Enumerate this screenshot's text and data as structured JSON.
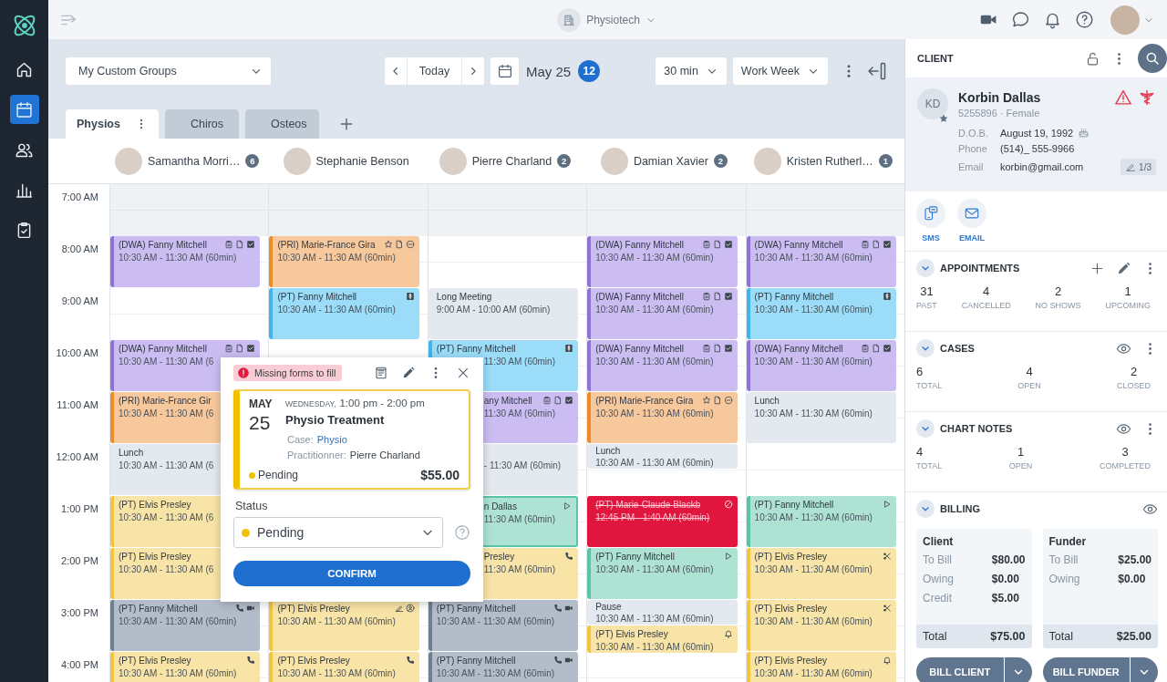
{
  "nav": [
    {
      "kind": "home",
      "selected": false
    },
    {
      "kind": "calendar",
      "selected": true
    },
    {
      "kind": "people",
      "selected": false
    },
    {
      "kind": "chart",
      "selected": false
    },
    {
      "kind": "tasks",
      "selected": false
    }
  ],
  "topbar": {
    "organization": "Physiotech"
  },
  "toolbar": {
    "group": "My Custom Groups",
    "today": "Today",
    "date": "May 25",
    "date_badge": "12",
    "interval": "30 min",
    "view": "Work Week"
  },
  "tabs": [
    {
      "label": "Physios",
      "selected": true
    },
    {
      "label": "Chiros",
      "selected": false
    },
    {
      "label": "Osteos",
      "selected": false
    }
  ],
  "practitioners": [
    {
      "name": "Samantha Morri…",
      "count": "6"
    },
    {
      "name": "Stephanie Benson"
    },
    {
      "name": "Pierre Charland",
      "count": "2"
    },
    {
      "name": "Damian Xavier",
      "count": "2"
    },
    {
      "name": "Kristen Rutherl…",
      "count": "1"
    }
  ],
  "hours": [
    {
      "label": "7:00 AM",
      "off_hours": true,
      "cells": [
        [],
        [],
        [],
        [],
        []
      ]
    },
    {
      "label": "8:00 AM",
      "off_hours": false,
      "cells": [
        [
          {
            "kind": "assessment",
            "half": false,
            "selected": false,
            "title": "(DWA) Fanny Mitchell",
            "time": "10:30 AM - 11:30 AM (60min)",
            "icons": [
              {
                "kind": "clipboard"
              },
              {
                "kind": "file"
              },
              {
                "kind": "checkbox"
              }
            ]
          }
        ],
        [
          {
            "kind": "private",
            "half": false,
            "selected": false,
            "title": "(PRI) Marie-France Gira",
            "time": "10:30 AM - 11:30 AM (60min)",
            "icons": [
              {
                "kind": "star"
              },
              {
                "kind": "file"
              },
              {
                "kind": "minus"
              }
            ]
          }
        ],
        [],
        [
          {
            "kind": "assessment",
            "half": false,
            "selected": false,
            "title": "(DWA) Fanny Mitchell",
            "time": "10:30 AM - 11:30 AM (60min)",
            "icons": [
              {
                "kind": "clipboard"
              },
              {
                "kind": "file"
              },
              {
                "kind": "checkbox"
              }
            ]
          }
        ],
        [
          {
            "kind": "assessment",
            "half": false,
            "selected": false,
            "title": "(DWA) Fanny Mitchell",
            "time": "10:30 AM - 11:30 AM (60min)",
            "icons": [
              {
                "kind": "clipboard"
              },
              {
                "kind": "file"
              },
              {
                "kind": "checkbox"
              }
            ]
          }
        ]
      ]
    },
    {
      "label": "9:00 AM",
      "off_hours": false,
      "cells": [
        [],
        [
          {
            "kind": "insured",
            "half": false,
            "selected": false,
            "title": "(PT) Fanny Mitchell",
            "time": "10:30 AM - 11:30 AM (60min)",
            "icons": [
              {
                "kind": "dollar"
              }
            ]
          }
        ],
        [
          {
            "kind": "block",
            "half": false,
            "selected": false,
            "title": "Long Meeting",
            "time": "9:00 AM - 10:00 AM (60min)"
          }
        ],
        [
          {
            "kind": "assessment",
            "half": false,
            "selected": false,
            "title": "(DWA) Fanny Mitchell",
            "time": "10:30 AM - 11:30 AM (60min)",
            "icons": [
              {
                "kind": "clipboard"
              },
              {
                "kind": "file"
              },
              {
                "kind": "checkbox"
              }
            ]
          }
        ],
        [
          {
            "kind": "insured",
            "half": false,
            "selected": false,
            "title": "(PT) Fanny Mitchell",
            "time": "10:30 AM - 11:30 AM (60min)",
            "icons": [
              {
                "kind": "dollar"
              }
            ]
          }
        ]
      ]
    },
    {
      "label": "10:00 AM",
      "off_hours": false,
      "cells": [
        [
          {
            "kind": "assessment",
            "half": false,
            "selected": false,
            "title": "(DWA) Fanny Mitchell",
            "time": "10:30 AM - 11:30 AM (6",
            "icons": [
              {
                "kind": "clipboard"
              },
              {
                "kind": "file"
              },
              {
                "kind": "checkbox"
              }
            ]
          }
        ],
        [],
        [
          {
            "kind": "insured",
            "half": false,
            "selected": false,
            "behind_popup": true,
            "title": "(PT) Fanny Mitchell",
            "time": "11:30 AM (60min)",
            "icons": [
              {
                "kind": "dollar"
              }
            ]
          }
        ],
        [
          {
            "kind": "assessment",
            "half": false,
            "selected": false,
            "title": "(DWA) Fanny Mitchell",
            "time": "10:30 AM - 11:30 AM (60min)",
            "icons": [
              {
                "kind": "clipboard"
              },
              {
                "kind": "file"
              },
              {
                "kind": "checkbox"
              }
            ]
          }
        ],
        [
          {
            "kind": "assessment",
            "half": false,
            "selected": false,
            "title": "(DWA) Fanny Mitchell",
            "time": "10:30 AM - 11:30 AM (60min)",
            "icons": [
              {
                "kind": "clipboard"
              },
              {
                "kind": "file"
              },
              {
                "kind": "checkbox"
              }
            ]
          }
        ]
      ]
    },
    {
      "label": "11:00 AM",
      "off_hours": false,
      "cells": [
        [
          {
            "kind": "private",
            "half": false,
            "selected": false,
            "title": "(PRI) Marie-France Gir",
            "time": "10:30 AM - 11:30 AM (6"
          }
        ],
        [],
        [
          {
            "kind": "assessment",
            "half": false,
            "selected": false,
            "behind_popup": true,
            "title": "any Mitchell",
            "time": "11:30 AM (60min)",
            "icons": [
              {
                "kind": "clipboard"
              },
              {
                "kind": "file"
              },
              {
                "kind": "checkbox"
              }
            ]
          }
        ],
        [
          {
            "kind": "private",
            "half": false,
            "selected": false,
            "title": "(PRI) Marie-France Gira",
            "time": "10:30 AM - 11:30 AM (60min)",
            "icons": [
              {
                "kind": "star"
              },
              {
                "kind": "file"
              },
              {
                "kind": "minus"
              }
            ]
          }
        ],
        [
          {
            "kind": "block",
            "half": false,
            "selected": false,
            "title": "Lunch",
            "time": "10:30 AM - 11:30 AM (60min)"
          }
        ]
      ]
    },
    {
      "label": "12:00 AM",
      "off_hours": false,
      "cells": [
        [
          {
            "kind": "block",
            "half": false,
            "selected": false,
            "title": "Lunch",
            "time": "10:30 AM - 11:30 AM (6"
          }
        ],
        [],
        [
          {
            "kind": "block",
            "half": false,
            "selected": false,
            "behind_popup": true,
            "time": "- 11:30 AM (60min)"
          }
        ],
        [
          {
            "kind": "block",
            "half": true,
            "selected": false,
            "title": "Lunch",
            "time": "10:30 AM - 11:30 AM (60min)"
          }
        ],
        []
      ]
    },
    {
      "label": "1:00 PM",
      "off_hours": false,
      "cells": [
        [
          {
            "kind": "pending",
            "half": false,
            "selected": false,
            "title": "(PT) Elvis Presley",
            "time": "10:30 AM - 11:30 AM (6"
          }
        ],
        [],
        [
          {
            "kind": "arrived",
            "half": false,
            "selected": true,
            "behind_popup": true,
            "title": "n Dallas",
            "time": "11:30 AM (60min)",
            "icons": [
              {
                "kind": "play"
              }
            ]
          }
        ],
        [
          {
            "kind": "cancelled",
            "half": false,
            "selected": false,
            "title": "(PT) Marie-Claude Blackb",
            "time": "12:45 PM - 1:40 AM (60min)",
            "icons": [
              {
                "kind": "ban"
              }
            ]
          }
        ],
        [
          {
            "kind": "arrived",
            "half": false,
            "selected": false,
            "title": "(PT) Fanny Mitchell",
            "time": "10:30 AM - 11:30 AM (60min)",
            "icons": [
              {
                "kind": "play"
              }
            ]
          }
        ]
      ]
    },
    {
      "label": "2:00 PM",
      "off_hours": false,
      "cells": [
        [
          {
            "kind": "pending",
            "half": false,
            "selected": false,
            "title": "(PT) Elvis Presley",
            "time": "10:30 AM - 11:30 AM (6"
          }
        ],
        [],
        [
          {
            "kind": "pending",
            "half": false,
            "selected": false,
            "behind_popup": true,
            "title": "Presley",
            "time": "11:30 AM (60min)",
            "icons": [
              {
                "kind": "phone"
              }
            ]
          }
        ],
        [
          {
            "kind": "arrived",
            "half": false,
            "selected": false,
            "title": "(PT) Fanny Mitchell",
            "time": "10:30 AM - 11:30 AM (60min)",
            "icons": [
              {
                "kind": "play"
              }
            ]
          }
        ],
        [
          {
            "kind": "pending",
            "half": false,
            "selected": false,
            "title": "(PT) Elvis Presley",
            "time": "10:30 AM - 11:30 AM (60min)",
            "icons": [
              {
                "kind": "scissors"
              }
            ]
          }
        ]
      ]
    },
    {
      "label": "3:00 PM",
      "off_hours": false,
      "cells": [
        [
          {
            "kind": "confirmed",
            "half": false,
            "selected": false,
            "title": "(PT) Fanny Mitchell",
            "time": "10:30 AM - 11:30 AM (60min)",
            "icons": [
              {
                "kind": "phone"
              },
              {
                "kind": "video"
              }
            ]
          }
        ],
        [
          {
            "kind": "pending",
            "half": false,
            "selected": false,
            "title": "(PT) Elvis Presley",
            "time": "10:30 AM - 11:30 AM (60min)",
            "icons": [
              {
                "kind": "signature"
              },
              {
                "kind": "user"
              }
            ]
          }
        ],
        [
          {
            "kind": "confirmed",
            "half": false,
            "selected": false,
            "title": "(PT) Fanny Mitchell",
            "time": "10:30 AM - 11:30 AM (60min)",
            "icons": [
              {
                "kind": "phone"
              },
              {
                "kind": "video"
              }
            ]
          }
        ],
        [
          {
            "kind": "block",
            "half": true,
            "selected": false,
            "title": "Pause",
            "time": "10:30 AM - 11:30 AM (60min)"
          },
          {
            "kind": "pending",
            "half": false,
            "selected": false,
            "title": "(PT) Elvis Presley",
            "time": "10:30 AM - 11:30 AM (60min)",
            "icons": [
              {
                "kind": "bell"
              }
            ]
          }
        ],
        [
          {
            "kind": "pending",
            "half": false,
            "selected": false,
            "title": "(PT) Elvis Presley",
            "time": "10:30 AM - 11:30 AM (60min)",
            "icons": [
              {
                "kind": "scissors"
              }
            ]
          }
        ]
      ]
    },
    {
      "label": "4:00 PM",
      "off_hours": false,
      "cells": [
        [
          {
            "kind": "pending",
            "half": false,
            "selected": false,
            "title": "(PT) Elvis Presley",
            "time": "10:30 AM - 11:30 AM (60min)",
            "icons": [
              {
                "kind": "phone"
              }
            ]
          }
        ],
        [
          {
            "kind": "pending",
            "half": false,
            "selected": false,
            "title": "(PT) Elvis Presley",
            "time": "10:30 AM - 11:30 AM (60min)",
            "icons": [
              {
                "kind": "phone"
              }
            ]
          }
        ],
        [
          {
            "kind": "confirmed",
            "half": false,
            "selected": false,
            "title": "(PT) Fanny Mitchell",
            "time": "10:30 AM - 11:30 AM (60min)",
            "icons": [
              {
                "kind": "phone"
              },
              {
                "kind": "video"
              }
            ]
          }
        ],
        [],
        [
          {
            "kind": "pending",
            "half": false,
            "selected": false,
            "title": "(PT) Elvis Presley",
            "time": "10:30 AM - 11:30 AM (60min)",
            "icons": [
              {
                "kind": "bell"
              }
            ]
          }
        ]
      ]
    }
  ],
  "popup": {
    "alert": "Missing forms to fill",
    "month": "MAY",
    "day": "25",
    "weekday": "WEDNESDAY,",
    "time": "1:00 pm - 2:00 pm",
    "title": "Physio Treatment",
    "case_label": "Case:",
    "case": "Physio",
    "practitioner_label": "Practitionner:",
    "practitioner": "Pierre Charland",
    "status": "Pending",
    "price": "$55.00",
    "status_label": "Status",
    "status_value": "Pending",
    "confirm": "CONFIRM"
  },
  "client": {
    "title": "CLIENT",
    "initials": "KD",
    "name": "Korbin Dallas",
    "id_line": "5255896 · Female",
    "fields": [
      {
        "label": "D.O.B.",
        "value": "August 19, 1992"
      },
      {
        "label": "Phone",
        "value": "(514)_ 555-9966"
      },
      {
        "label": "Email",
        "value": "korbin@gmail.com"
      }
    ],
    "forms": "1/3",
    "actions": [
      {
        "kind": "sms",
        "label": "SMS"
      },
      {
        "kind": "email",
        "label": "EMAIL"
      }
    ]
  },
  "sections": [
    {
      "kind": "stats",
      "title": "APPOINTMENTS",
      "tools": [
        {
          "kind": "add"
        },
        {
          "kind": "edit"
        },
        {
          "kind": "more"
        }
      ],
      "stats": [
        {
          "value": "31",
          "label": "PAST"
        },
        {
          "value": "4",
          "label": "CANCELLED"
        },
        {
          "value": "2",
          "label": "NO SHOWS"
        },
        {
          "value": "1",
          "label": "UPCOMING"
        }
      ]
    },
    {
      "kind": "stats",
      "title": "CASES",
      "tools": [
        {
          "kind": "view"
        },
        {
          "kind": "more"
        }
      ],
      "stats": [
        {
          "value": "6",
          "label": "TOTAL"
        },
        {
          "value": "4",
          "label": "OPEN"
        },
        {
          "value": "2",
          "label": "CLOSED"
        }
      ]
    },
    {
      "kind": "stats",
      "title": "CHART NOTES",
      "tools": [
        {
          "kind": "view"
        },
        {
          "kind": "more"
        }
      ],
      "stats": [
        {
          "value": "4",
          "label": "TOTAL"
        },
        {
          "value": "1",
          "label": "OPEN"
        },
        {
          "value": "3",
          "label": "COMPLETED"
        }
      ]
    },
    {
      "kind": "billing",
      "title": "BILLING",
      "tools": [
        {
          "kind": "view"
        }
      ],
      "cards": [
        {
          "title": "Client",
          "rows": [
            {
              "label": "To Bill",
              "value": "$80.00"
            },
            {
              "label": "Owing",
              "value": "$0.00"
            },
            {
              "label": "Credit",
              "value": "$5.00"
            }
          ],
          "total_label": "Total",
          "total": "$75.00",
          "button": "BILL CLIENT"
        },
        {
          "title": "Funder",
          "rows": [
            {
              "label": "To Bill",
              "value": "$25.00"
            },
            {
              "label": "Owing",
              "value": "$0.00"
            }
          ],
          "total_label": "Total",
          "total": "$25.00",
          "button": "BILL FUNDER"
        }
      ]
    }
  ]
}
